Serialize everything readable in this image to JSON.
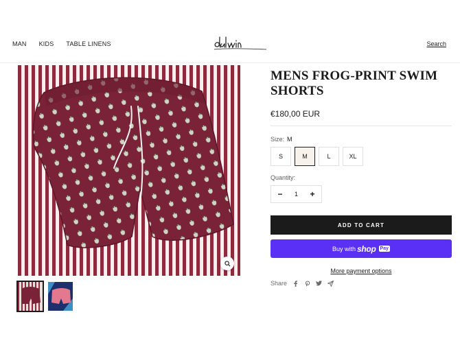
{
  "nav": {
    "items": [
      "MAN",
      "KIDS",
      "TABLE LINENS"
    ],
    "search_label": "Search",
    "logo_text": "dalwin"
  },
  "product": {
    "title": "MENS FROG-PRINT SWIM SHORTS",
    "price": "€180,00 EUR",
    "size_label": "Size:",
    "selected_size": "M",
    "sizes": [
      "S",
      "M",
      "L",
      "XL"
    ],
    "quantity_label": "Quantity:",
    "quantity": "1",
    "minus": "−",
    "plus": "+",
    "add_to_cart": "ADD TO CART",
    "buy_with": "Buy with",
    "shop": "shop",
    "pay": "Pay",
    "more_payment": "More payment options",
    "share_label": "Share"
  },
  "colors": {
    "accent_dark": "#1c1b1b",
    "shop_pay": "#5a31f4",
    "shorts": "#7a2338",
    "stripe": "#8d2a3c"
  },
  "icons": [
    "zoom-icon",
    "facebook-icon",
    "pinterest-icon",
    "twitter-icon",
    "email-icon"
  ]
}
